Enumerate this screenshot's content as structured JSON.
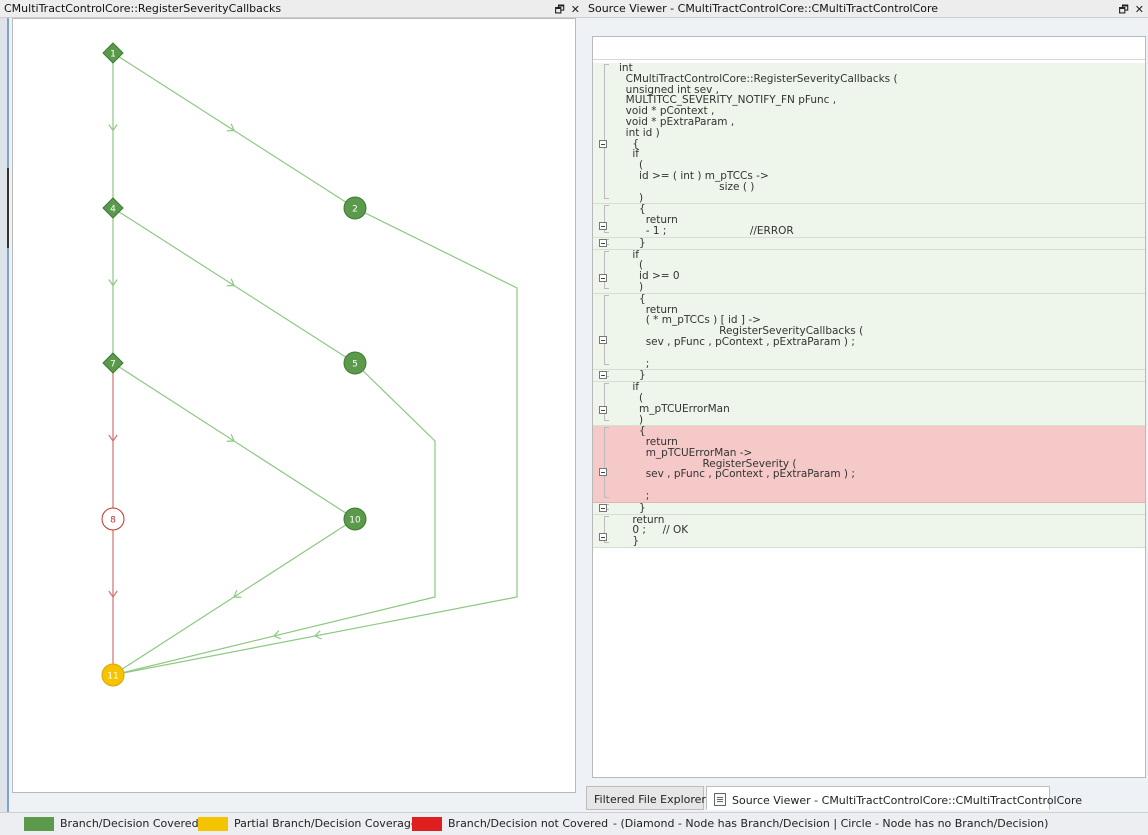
{
  "graph_panel": {
    "title": "CMultiTractControlCore::RegisterSeverityCallbacks",
    "pin_icon": "pin-icon",
    "close_icon": "close-icon",
    "colors": {
      "covered": "#5b9a4b",
      "not_covered": "#c9302c",
      "partial": "#f5c400",
      "edge_green": "#8dc882",
      "edge_red": "#d47070"
    },
    "nodes": [
      {
        "id": "1",
        "shape": "diamond",
        "status": "covered"
      },
      {
        "id": "2",
        "shape": "circle",
        "status": "covered"
      },
      {
        "id": "4",
        "shape": "diamond",
        "status": "covered"
      },
      {
        "id": "5",
        "shape": "circle",
        "status": "covered"
      },
      {
        "id": "7",
        "shape": "diamond",
        "status": "covered"
      },
      {
        "id": "8",
        "shape": "circle",
        "status": "not_covered"
      },
      {
        "id": "10",
        "shape": "circle",
        "status": "covered"
      },
      {
        "id": "11",
        "shape": "circle",
        "status": "partial"
      }
    ]
  },
  "source_panel": {
    "title": "Source Viewer - CMultiTractControlCore::CMultiTractControlCore",
    "pin_icon": "pin-icon",
    "close_icon": "close-icon",
    "blocks": [
      {
        "status": "covered",
        "lines": [
          "int",
          "  CMultiTractControlCore::RegisterSeverityCallbacks (",
          "  unsigned int sev ,",
          "  MULTITCC_SEVERITY_NOTIFY_FN pFunc ,",
          "  void * pContext ,",
          "  void * pExtraParam ,",
          "  int id )",
          "    {",
          "    if",
          "      (",
          "      id >= ( int ) m_pTCCs ->",
          "                              size ( )",
          "      )"
        ]
      },
      {
        "status": "covered",
        "lines": [
          "      {",
          "        return",
          "        - 1 ;                         //ERROR"
        ]
      },
      {
        "status": "covered",
        "lines": [
          "      }"
        ]
      },
      {
        "status": "covered",
        "lines": [
          "    if",
          "      (",
          "      id >= 0",
          "      )"
        ]
      },
      {
        "status": "covered",
        "lines": [
          "      {",
          "        return",
          "        ( * m_pTCCs ) [ id ] ->",
          "                              RegisterSeverityCallbacks (",
          "        sev , pFunc , pContext , pExtraParam ) ;",
          "",
          "        ;"
        ]
      },
      {
        "status": "covered",
        "lines": [
          "      }"
        ]
      },
      {
        "status": "covered",
        "lines": [
          "    if",
          "      (",
          "      m_pTCUErrorMan",
          "      )"
        ]
      },
      {
        "status": "not_covered",
        "lines": [
          "      {",
          "        return",
          "        m_pTCUErrorMan ->",
          "                         RegisterSeverity (",
          "        sev , pFunc , pContext , pExtraParam ) ;",
          "",
          "        ;"
        ]
      },
      {
        "status": "covered",
        "lines": [
          "      }"
        ]
      },
      {
        "status": "covered",
        "lines": [
          "    return",
          "    0 ;     // OK",
          "    }"
        ]
      }
    ]
  },
  "bottom_tabs": [
    {
      "label": "Filtered File Explorer",
      "active": false
    },
    {
      "label": "Source Viewer - CMultiTractControlCore::CMultiTractControlCore",
      "active": true,
      "icon": "document-icon"
    }
  ],
  "legend": {
    "items": [
      {
        "label": "Branch/Decision Covered",
        "color": "#5b9a4b"
      },
      {
        "label": "Partial Branch/Decision Coverage",
        "color": "#f5c400"
      },
      {
        "label": "Branch/Decision not Covered",
        "color": "#dd1f1f"
      }
    ],
    "note": "- (Diamond - Node has Branch/Decision | Circle - Node has no Branch/Decision)"
  }
}
